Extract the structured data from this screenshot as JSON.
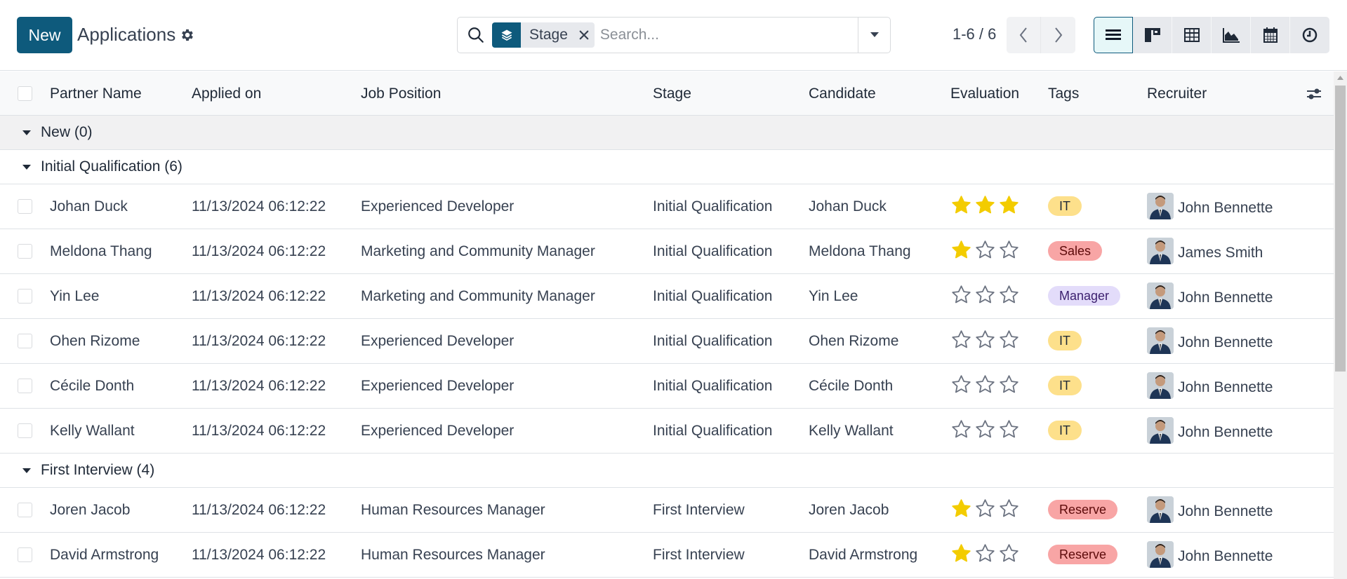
{
  "control_panel": {
    "new_button": "New",
    "title": "Applications",
    "search": {
      "facet_label": "Stage",
      "facet_icon": "layers-icon",
      "placeholder": "Search...",
      "value": ""
    },
    "pager": {
      "value": "1-6 / 6"
    },
    "views": [
      {
        "name": "list",
        "icon": "list-icon",
        "active": true
      },
      {
        "name": "kanban",
        "icon": "kanban-icon",
        "active": false
      },
      {
        "name": "pivot",
        "icon": "pivot-table-icon",
        "active": false
      },
      {
        "name": "graph",
        "icon": "area-chart-icon",
        "active": false
      },
      {
        "name": "calendar",
        "icon": "calendar-icon",
        "active": false
      },
      {
        "name": "activity",
        "icon": "clock-icon",
        "active": false
      }
    ]
  },
  "table": {
    "columns": [
      "Partner Name",
      "Applied on",
      "Job Position",
      "Stage",
      "Candidate",
      "Evaluation",
      "Tags",
      "Recruiter"
    ],
    "groups": [
      {
        "label": "New (0)",
        "rows": []
      },
      {
        "label": "Initial Qualification (6)",
        "rows": [
          {
            "partner": "Johan Duck",
            "applied": "11/13/2024 06:12:22",
            "job": "Experienced Developer",
            "stage": "Initial Qualification",
            "candidate": "Johan Duck",
            "evaluation": 3,
            "tag": "IT",
            "recruiter": "John Bennette"
          },
          {
            "partner": "Meldona Thang",
            "applied": "11/13/2024 06:12:22",
            "job": "Marketing and Community Manager",
            "stage": "Initial Qualification",
            "candidate": "Meldona Thang",
            "evaluation": 1,
            "tag": "Sales",
            "recruiter": "James Smith"
          },
          {
            "partner": "Yin Lee",
            "applied": "11/13/2024 06:12:22",
            "job": "Marketing and Community Manager",
            "stage": "Initial Qualification",
            "candidate": "Yin Lee",
            "evaluation": 0,
            "tag": "Manager",
            "recruiter": "John Bennette"
          },
          {
            "partner": "Ohen Rizome",
            "applied": "11/13/2024 06:12:22",
            "job": "Experienced Developer",
            "stage": "Initial Qualification",
            "candidate": "Ohen Rizome",
            "evaluation": 0,
            "tag": "IT",
            "recruiter": "John Bennette"
          },
          {
            "partner": "Cécile Donth",
            "applied": "11/13/2024 06:12:22",
            "job": "Experienced Developer",
            "stage": "Initial Qualification",
            "candidate": "Cécile Donth",
            "evaluation": 0,
            "tag": "IT",
            "recruiter": "John Bennette"
          },
          {
            "partner": "Kelly Wallant",
            "applied": "11/13/2024 06:12:22",
            "job": "Experienced Developer",
            "stage": "Initial Qualification",
            "candidate": "Kelly Wallant",
            "evaluation": 0,
            "tag": "IT",
            "recruiter": "John Bennette"
          }
        ]
      },
      {
        "label": "First Interview (4)",
        "rows": [
          {
            "partner": "Joren Jacob",
            "applied": "11/13/2024 06:12:22",
            "job": "Human Resources Manager",
            "stage": "First Interview",
            "candidate": "Joren Jacob",
            "evaluation": 1,
            "tag": "Reserve",
            "recruiter": "John Bennette"
          },
          {
            "partner": "David Armstrong",
            "applied": "11/13/2024 06:12:22",
            "job": "Human Resources Manager",
            "stage": "First Interview",
            "candidate": "David Armstrong",
            "evaluation": 1,
            "tag": "Reserve",
            "recruiter": "John Bennette"
          }
        ]
      }
    ],
    "evaluation_max": 3
  },
  "colors": {
    "primary": "#0e5a7c",
    "star_filled": "#f3cc00",
    "star_empty": "#6b7280",
    "tags": {
      "IT": "#fde08b",
      "Sales": "#f8a5a5",
      "Manager": "#e3dcfa",
      "Reserve": "#f8a5a5"
    }
  }
}
